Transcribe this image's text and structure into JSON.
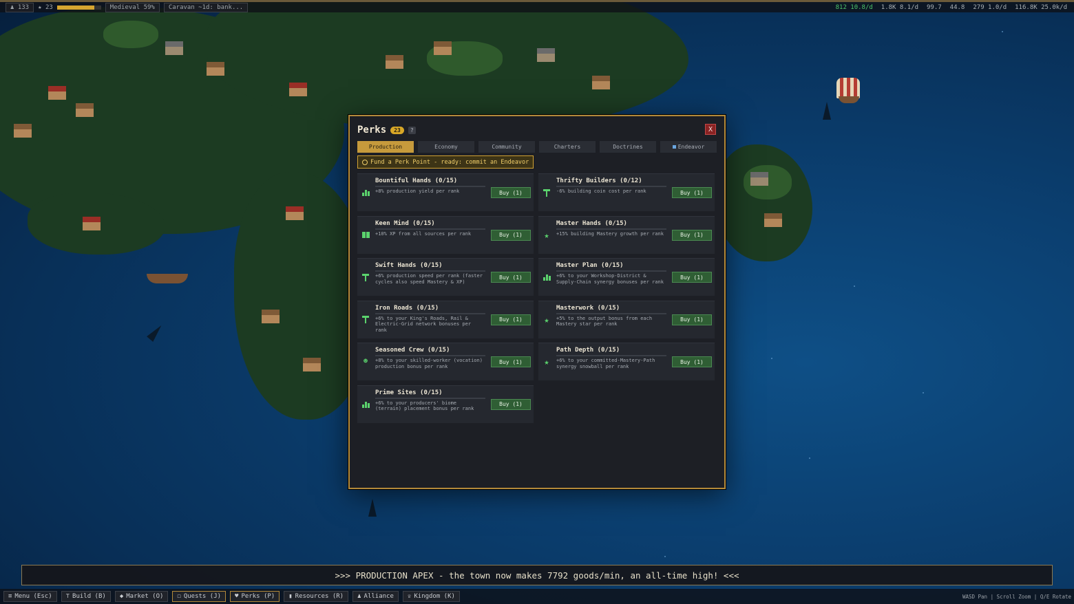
{
  "hud_top": {
    "population": "133",
    "stars": "23",
    "xp_progress": 0.85,
    "era": "Medieval 59%",
    "caravan": "Caravan ~1d: bank...",
    "stats": [
      "812 10.8/d",
      "1.8K 8.1/d",
      "99.7",
      "44.8",
      "279 1.0/d",
      "116.8K 25.0k/d"
    ]
  },
  "perks": {
    "title": "Perks",
    "points": "23",
    "help": "?",
    "close": "X",
    "tabs": [
      "Production",
      "Economy",
      "Community",
      "Charters",
      "Doctrines",
      "Endeavor"
    ],
    "active_tab": "Production",
    "fund": "Fund a Perk Point - ready: commit an Endeavor",
    "cards": [
      {
        "name": "Bountiful Hands  (0/15)",
        "desc": "+8% production yield per rank",
        "buy": "Buy (1)",
        "icon": "bars-icon"
      },
      {
        "name": "Thrifty Builders  (0/12)",
        "desc": "-6% building coin cost per rank",
        "buy": "Buy (1)",
        "icon": "hammer-icon"
      },
      {
        "name": "Keen Mind  (0/15)",
        "desc": "+10% XP from all sources per rank",
        "buy": "Buy (1)",
        "icon": "book-icon"
      },
      {
        "name": "Master Hands  (0/15)",
        "desc": "+15% building Mastery growth per rank",
        "buy": "Buy (1)",
        "icon": "star-icon"
      },
      {
        "name": "Swift Hands  (0/15)",
        "desc": "+6% production speed per rank (faster cycles also speed Mastery & XP)",
        "buy": "Buy (1)",
        "icon": "hammer-icon"
      },
      {
        "name": "Master Plan  (0/15)",
        "desc": "+6% to your Workshop-District & Supply-Chain synergy bonuses per rank",
        "buy": "Buy (1)",
        "icon": "bars-icon"
      },
      {
        "name": "Iron Roads  (0/15)",
        "desc": "+6% to your King's Roads, Rail & Electric-Grid network bonuses per rank",
        "buy": "Buy (1)",
        "icon": "hammer-icon"
      },
      {
        "name": "Masterwork  (0/15)",
        "desc": "+5% to the output bonus from each Mastery star per rank",
        "buy": "Buy (1)",
        "icon": "star-icon"
      },
      {
        "name": "Seasoned Crew  (0/15)",
        "desc": "+8% to your skilled-worker (vocation) production bonus per rank",
        "buy": "Buy (1)",
        "icon": "people-icon"
      },
      {
        "name": "Path Depth  (0/15)",
        "desc": "+6% to your committed-Mastery-Path synergy snowball per rank",
        "buy": "Buy (1)",
        "icon": "star-icon"
      },
      {
        "name": "Prime Sites  (0/15)",
        "desc": "+6% to your producers' biome (terrain) placement bonus per rank",
        "buy": "Buy (1)",
        "icon": "bars-icon"
      }
    ]
  },
  "banner": ">>> PRODUCTION APEX - the town now makes 7792 goods/min, an all-time high! <<<",
  "bottom_nav": [
    "Menu (Esc)",
    "Build (B)",
    "Market (O)",
    "Quests (J)",
    "Perks (P)",
    "Resources (R)",
    "Alliance",
    "Kingdom (K)"
  ],
  "bottom_icons": [
    "menu-icon",
    "hammer-icon",
    "tag-icon",
    "quest-icon",
    "heart-icon",
    "bars-icon",
    "people-icon",
    "crown-icon"
  ],
  "controls_hint": "WASD Pan | Scroll Zoom | Q/E Rotate"
}
